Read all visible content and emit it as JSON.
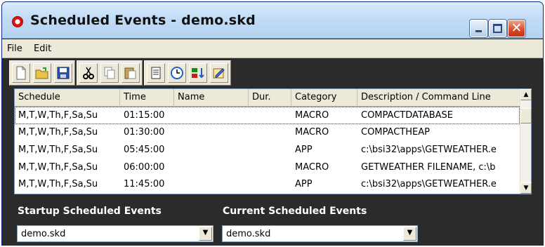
{
  "window": {
    "title": "Scheduled Events - demo.skd",
    "close_glyph": "✕"
  },
  "menu": [
    "File",
    "Edit"
  ],
  "toolbar_icons": [
    "new-file-icon",
    "open-folder-icon",
    "save-icon",
    "cut-icon",
    "copy-icon",
    "paste-icon",
    "properties-icon",
    "clock-icon",
    "sort-time-icon",
    "edit-schedule-icon"
  ],
  "list": {
    "columns": [
      "Schedule",
      "Time",
      "Name",
      "Dur.",
      "Category",
      "Description / Command Line"
    ],
    "rows": [
      [
        "M,T,W,Th,F,Sa,Su",
        "01:15:00",
        "",
        "",
        "MACRO",
        "COMPACTDATABASE"
      ],
      [
        "M,T,W,Th,F,Sa,Su",
        "01:30:00",
        "",
        "",
        "MACRO",
        "COMPACTHEAP"
      ],
      [
        "M,T,W,Th,F,Sa,Su",
        "05:45:00",
        "",
        "",
        "APP",
        "c:\\bsi32\\apps\\GETWEATHER.e"
      ],
      [
        "M,T,W,Th,F,Sa,Su",
        "06:00:00",
        "",
        "",
        "MACRO",
        "GETWEATHER FILENAME, c:\\b"
      ],
      [
        "M,T,W,Th,F,Sa,Su",
        "11:45:00",
        "",
        "",
        "APP",
        "c:\\bsi32\\apps\\GETWEATHER.e"
      ]
    ],
    "selected_row": 0
  },
  "startup": {
    "label": "Startup Scheduled Events",
    "value": "demo.skd"
  },
  "current": {
    "label": "Current Scheduled Events",
    "value": "demo.skd"
  },
  "colors": {
    "title_bar": "#c2dcf6",
    "panel_background": "#2b2b2b",
    "close_button": "#d54a25"
  }
}
